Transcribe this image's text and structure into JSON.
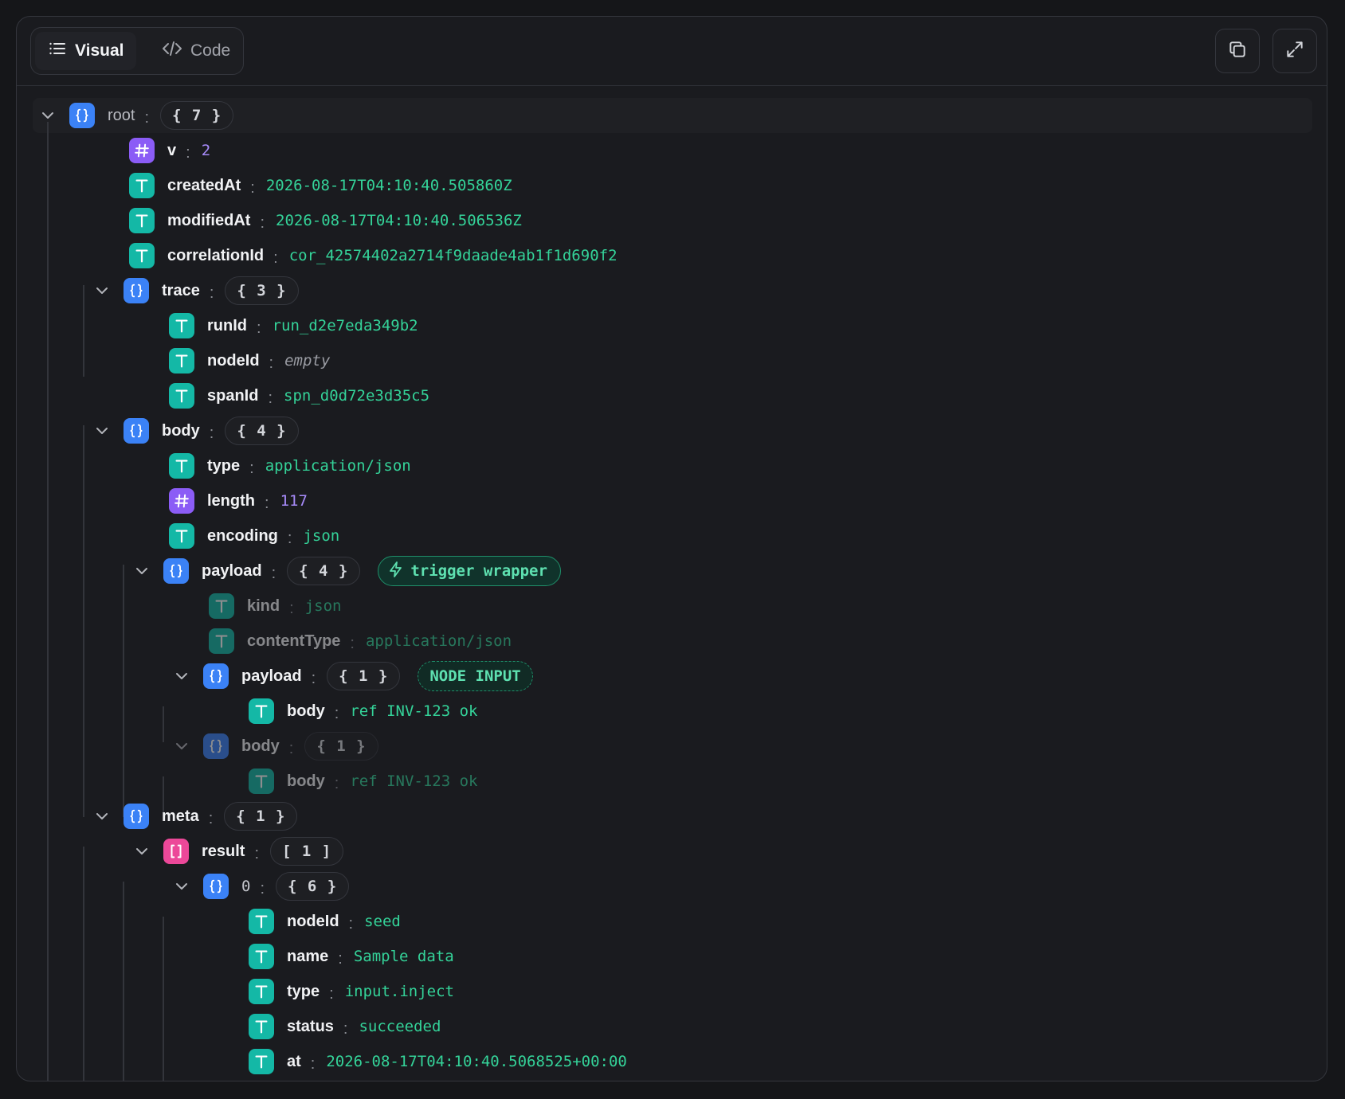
{
  "toolbar": {
    "visual_label": "Visual",
    "code_label": "Code",
    "copy_icon": "copy-icon",
    "expand_icon": "expand-icon"
  },
  "colors": {
    "string": "#14b8a6",
    "number": "#8b5cf6",
    "object": "#3b82f6",
    "array": "#ec4899",
    "value_string": "#34d399",
    "value_number": "#a78bfa"
  },
  "tree": {
    "root": {
      "key": "root",
      "count": "{ 7 }"
    },
    "v": {
      "key": "v",
      "value": "2"
    },
    "createdAt": {
      "key": "createdAt",
      "value": "2026-08-17T04:10:40.505860Z"
    },
    "modifiedAt": {
      "key": "modifiedAt",
      "value": "2026-08-17T04:10:40.506536Z"
    },
    "correlationId": {
      "key": "correlationId",
      "value": "cor_42574402a2714f9daade4ab1f1d690f2"
    },
    "trace": {
      "key": "trace",
      "count": "{ 3 }",
      "runId": {
        "key": "runId",
        "value": "run_d2e7eda349b2"
      },
      "nodeId": {
        "key": "nodeId",
        "value": "empty"
      },
      "spanId": {
        "key": "spanId",
        "value": "spn_d0d72e3d35c5"
      }
    },
    "body": {
      "key": "body",
      "count": "{ 4 }",
      "type": {
        "key": "type",
        "value": "application/json"
      },
      "length": {
        "key": "length",
        "value": "117"
      },
      "encoding": {
        "key": "encoding",
        "value": "json"
      },
      "payload": {
        "key": "payload",
        "count": "{ 4 }",
        "badge": "trigger wrapper",
        "kind": {
          "key": "kind",
          "value": "json"
        },
        "contentType": {
          "key": "contentType",
          "value": "application/json"
        },
        "inner_payload": {
          "key": "payload",
          "count": "{ 1 }",
          "badge": "NODE INPUT",
          "body": {
            "key": "body",
            "value": "ref INV-123 ok"
          }
        },
        "inner_body": {
          "key": "body",
          "count": "{ 1 }",
          "body": {
            "key": "body",
            "value": "ref INV-123 ok"
          }
        }
      }
    },
    "meta": {
      "key": "meta",
      "count": "{ 1 }",
      "result": {
        "key": "result",
        "count": "[ 1 ]",
        "item0": {
          "key": "0",
          "count": "{ 6 }",
          "nodeId": {
            "key": "nodeId",
            "value": "seed"
          },
          "name": {
            "key": "name",
            "value": "Sample data"
          },
          "type": {
            "key": "type",
            "value": "input.inject"
          },
          "status": {
            "key": "status",
            "value": "succeeded"
          },
          "at": {
            "key": "at",
            "value": "2026-08-17T04:10:40.5068525+00:00"
          }
        }
      }
    }
  }
}
